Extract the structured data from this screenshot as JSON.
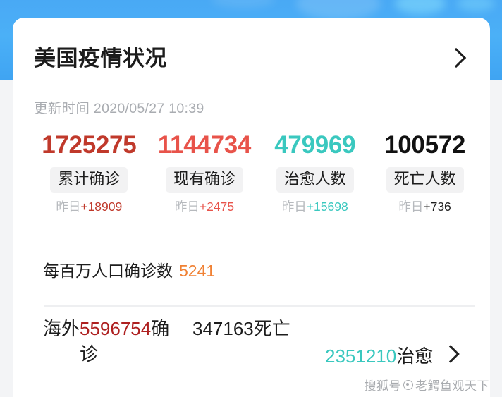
{
  "banner": {
    "color": "#49a9f5"
  },
  "card": {
    "title": "美国疫情状况",
    "expand_icon": "chevron-right-icon",
    "update_time": "更新时间 2020/05/27 10:39"
  },
  "stats": [
    {
      "value": "1725275",
      "label": "累计确诊",
      "delta_prefix": "昨日",
      "delta_value": "+18909",
      "value_color": "#c0392b",
      "delta_color": "#c0392b"
    },
    {
      "value": "1144734",
      "label": "现有确诊",
      "delta_prefix": "昨日",
      "delta_value": "+2475",
      "value_color": "#e8534a",
      "delta_color": "#e8534a"
    },
    {
      "value": "479969",
      "label": "治愈人数",
      "delta_prefix": "昨日",
      "delta_value": "+15698",
      "value_color": "#3ac8bf",
      "delta_color": "#3ac8bf"
    },
    {
      "value": "100572",
      "label": "死亡人数",
      "delta_prefix": "昨日",
      "delta_value": "+736",
      "value_color": "#111111",
      "delta_color": "#1d1d1d"
    }
  ],
  "per_million": {
    "label": "每百万人口确诊数",
    "value": "5241",
    "value_color": "#f08134"
  },
  "overseas": {
    "label": "海外",
    "confirmed_number": "5596754",
    "confirmed_unit": "确诊",
    "deaths_number": "347163",
    "deaths_unit": "死亡",
    "healed_number": "2351210",
    "healed_unit": "治愈",
    "expand_icon": "chevron-right-icon"
  },
  "watermark": {
    "prefix": "搜狐号",
    "icon": "circle-dot-icon",
    "author": "老鳄鱼观天下"
  }
}
